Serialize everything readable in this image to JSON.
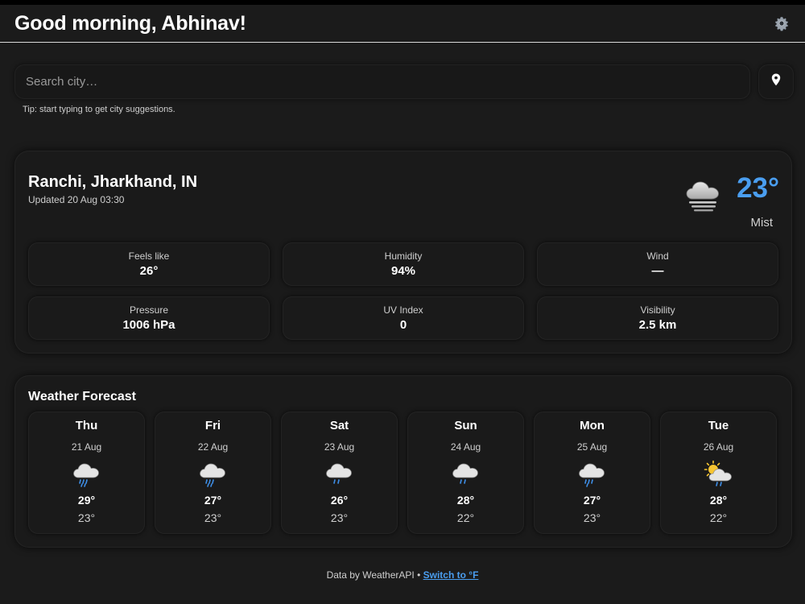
{
  "header": {
    "greeting": "Good morning, Abhinav!",
    "settings_icon": "gear-icon"
  },
  "search": {
    "placeholder": "Search city…",
    "value": "",
    "tip": "Tip: start typing to get city suggestions.",
    "location_icon": "location-pin-icon"
  },
  "current": {
    "location": "Ranchi, Jharkhand, IN",
    "updated": "Updated 20 Aug 03:30",
    "temp": "23°",
    "condition": "Mist",
    "icon": "mist-cloud-icon",
    "stats": [
      {
        "label": "Feels like",
        "value": "26°"
      },
      {
        "label": "Humidity",
        "value": "94%"
      },
      {
        "label": "Wind",
        "value": "—"
      },
      {
        "label": "Pressure",
        "value": "1006 hPa"
      },
      {
        "label": "UV Index",
        "value": "0"
      },
      {
        "label": "Visibility",
        "value": "2.5 km"
      }
    ]
  },
  "forecast": {
    "title": "Weather Forecast",
    "days": [
      {
        "day": "Thu",
        "date": "21 Aug",
        "max": "29°",
        "min": "23°",
        "icon": "rain-cloud-icon"
      },
      {
        "day": "Fri",
        "date": "22 Aug",
        "max": "27°",
        "min": "23°",
        "icon": "rain-cloud-icon"
      },
      {
        "day": "Sat",
        "date": "23 Aug",
        "max": "26°",
        "min": "23°",
        "icon": "rain-cloud-icon"
      },
      {
        "day": "Sun",
        "date": "24 Aug",
        "max": "28°",
        "min": "22°",
        "icon": "rain-cloud-icon"
      },
      {
        "day": "Mon",
        "date": "25 Aug",
        "max": "27°",
        "min": "23°",
        "icon": "rain-cloud-icon"
      },
      {
        "day": "Tue",
        "date": "26 Aug",
        "max": "28°",
        "min": "22°",
        "icon": "sun-rain-cloud-icon"
      }
    ]
  },
  "footer": {
    "credit": "Data by WeatherAPI • ",
    "unit_link": "Switch to °F"
  },
  "colors": {
    "accent": "#4a9ef0",
    "background": "#1b1b1b",
    "card": "#1a1a1a"
  }
}
